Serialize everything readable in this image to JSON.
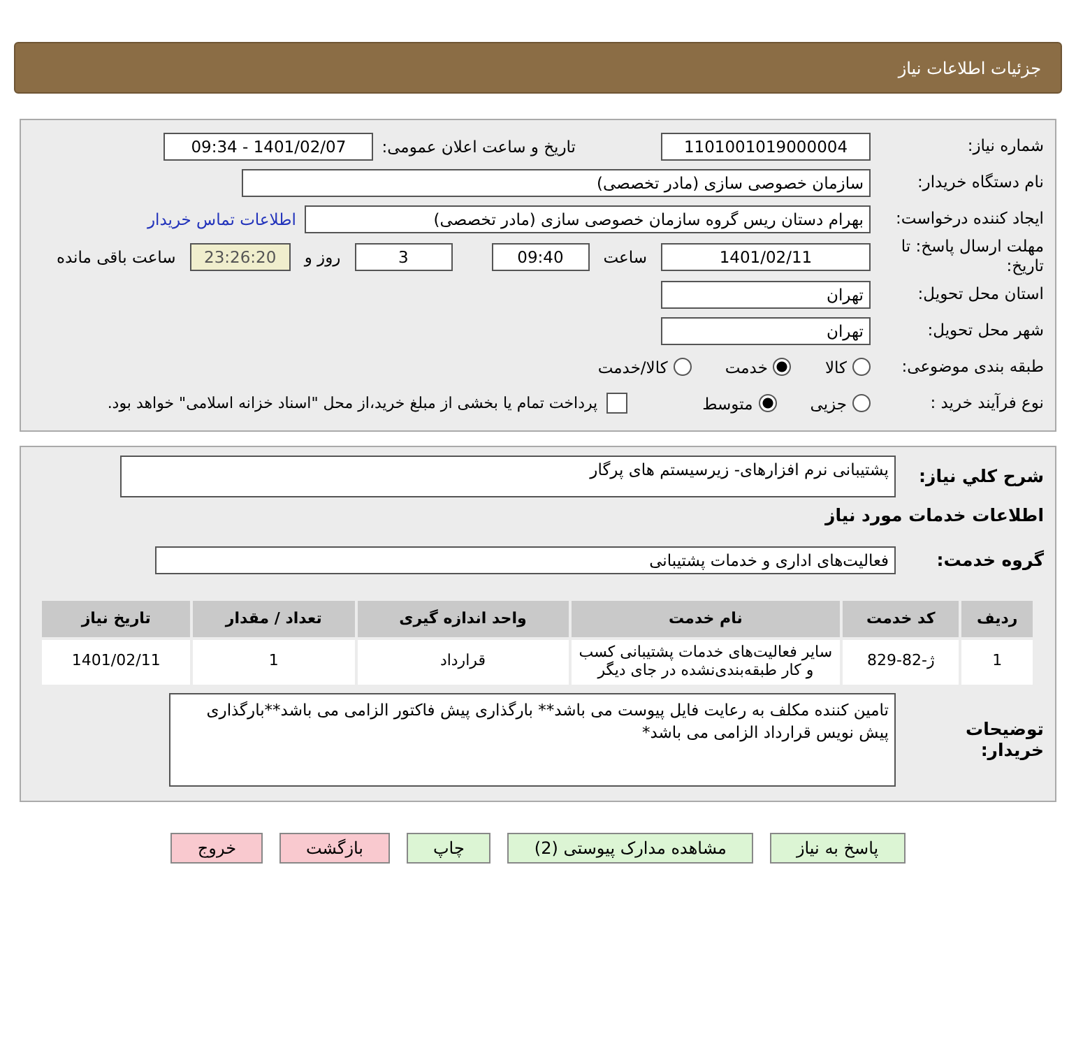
{
  "header": {
    "title": "جزئیات اطلاعات نیاز"
  },
  "details": {
    "need_number": {
      "label": "شماره نیاز:",
      "value": "1101001019000004"
    },
    "announce": {
      "label": "تاریخ و ساعت اعلان عمومی:",
      "value": "1401/02/07 - 09:34"
    },
    "buyer_org": {
      "label": "نام دستگاه خریدار:",
      "value": "سازمان خصوصی سازی (مادر تخصصی)"
    },
    "requester": {
      "label": "ایجاد کننده درخواست:",
      "value": "بهرام دستان ریس گروه سازمان خصوصی سازی (مادر تخصصی)",
      "link": "اطلاعات تماس خریدار"
    },
    "deadline": {
      "label": "مهلت ارسال پاسخ: تا تاریخ:",
      "date": "1401/02/11",
      "time_label": "ساعت",
      "time": "09:40",
      "days": "3",
      "days_label": "روز و",
      "remaining": "23:26:20",
      "remaining_label": "ساعت باقی مانده"
    },
    "province": {
      "label": "استان محل تحویل:",
      "value": "تهران"
    },
    "city": {
      "label": "شهر محل تحویل:",
      "value": "تهران"
    },
    "category": {
      "label": "طبقه بندی موضوعی:",
      "options": [
        {
          "label": "کالا",
          "selected": false
        },
        {
          "label": "خدمت",
          "selected": true
        },
        {
          "label": "کالا/خدمت",
          "selected": false
        }
      ]
    },
    "process": {
      "label": "نوع فرآیند خرید :",
      "options": [
        {
          "label": "جزیی",
          "selected": false
        },
        {
          "label": "متوسط",
          "selected": true
        }
      ],
      "payment": {
        "checked": false,
        "text": "پرداخت تمام یا بخشی از مبلغ خرید،از محل \"اسناد خزانه اسلامی\" خواهد بود."
      }
    }
  },
  "need": {
    "summary": {
      "label": "شرح کلي نیاز:",
      "value": "پشتیبانی نرم افزارهای- زیرسیستم های پرگار"
    },
    "services_heading": "اطلاعات خدمات مورد نیاز",
    "service_group": {
      "label": "گروه خدمت:",
      "value": "فعالیت‌های اداری و خدمات پشتیبانی"
    },
    "table": {
      "columns": [
        "ردیف",
        "کد خدمت",
        "نام خدمت",
        "واحد اندازه گیری",
        "تعداد / مقدار",
        "تاریخ نیاز"
      ],
      "rows": [
        [
          "1",
          "ژ-82-829",
          "سایر فعالیت‌های خدمات پشتیبانی کسب و کار طبقه‌بندی‌نشده در جای دیگر",
          "قرارداد",
          "1",
          "1401/02/11"
        ]
      ]
    },
    "notes": {
      "label": "توضیحات خریدار:",
      "value": "تامین کننده مکلف به رعایت فایل پیوست می باشد** بارگذاری پیش فاکتور الزامی می باشد**بارگذاری پیش نویس قرارداد الزامی می باشد*"
    }
  },
  "buttons": [
    {
      "label": "پاسخ به نیاز",
      "color": "#dcf5d4"
    },
    {
      "label": "مشاهده مدارک پیوستی (2)",
      "color": "#dcf5d4"
    },
    {
      "label": "چاپ",
      "color": "#dcf5d4"
    },
    {
      "label": "بازگشت",
      "color": "#f9c9cf"
    },
    {
      "label": "خروج",
      "color": "#f9c9cf"
    }
  ]
}
